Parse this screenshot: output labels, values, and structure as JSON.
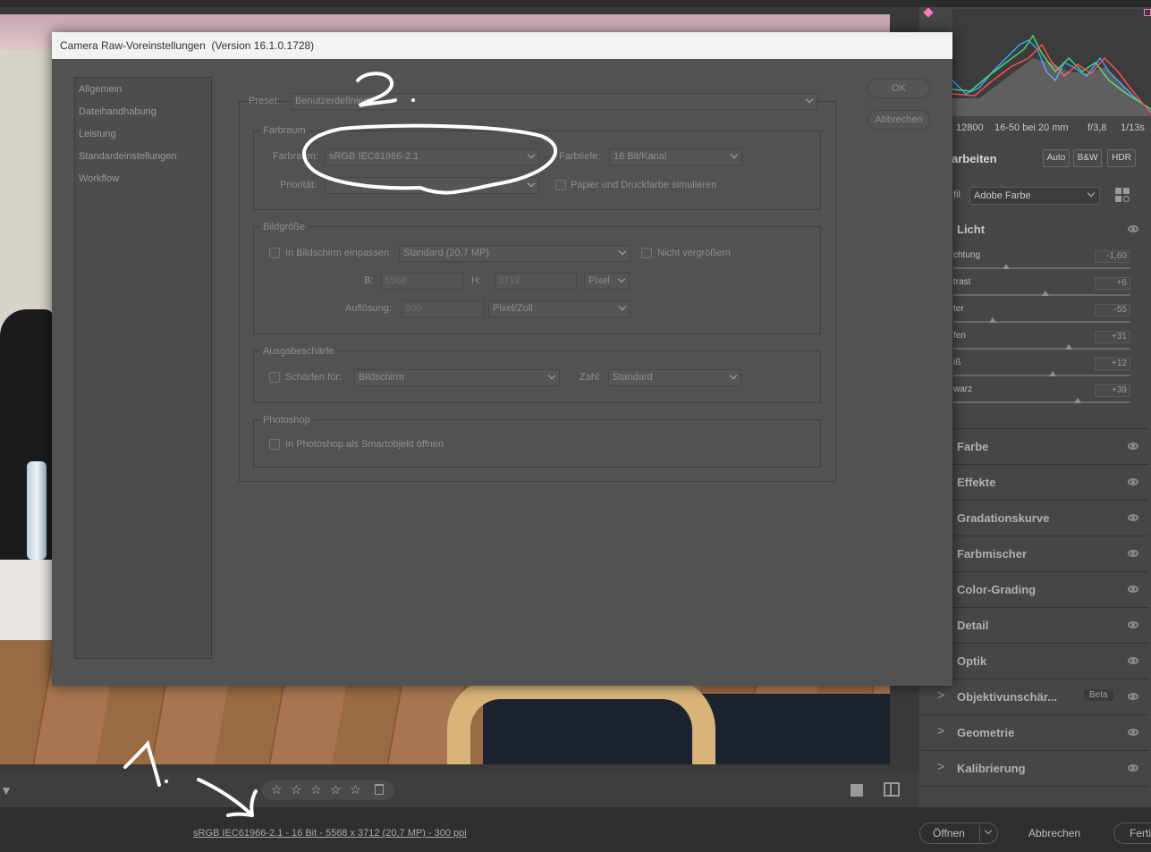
{
  "dialog": {
    "title": "Camera Raw-Voreinstellungen",
    "version": "(Version 16.1.0.1728)",
    "nav": [
      "Allgemein",
      "Dateihandhabung",
      "Leistung",
      "Standardeinstellungen",
      "Workflow"
    ],
    "ok_label": "OK",
    "cancel_label": "Abbrechen",
    "preset_label": "Preset:",
    "preset_value": "Benutzerdefiniert",
    "farbraum": {
      "title": "Farbraum",
      "farbraum_label": "Farbraum:",
      "farbraum_value": "sRGB IEC61966-2.1",
      "farbtiefe_label": "Farbtiefe:",
      "farbtiefe_value": "16 Bit/Kanal",
      "prioritaet_label": "Priorität:",
      "prioritaet_value": "",
      "simulate_label": "Papier und Druckfarbe simulieren"
    },
    "bildgroesse": {
      "title": "Bildgröße",
      "fit_label": "In Bildschirm einpassen:",
      "fit_value": "Standard  (20,7 MP)",
      "no_enlarge_label": "Nicht vergrößern",
      "w_label": "B:",
      "w_value": "5568",
      "h_label": "H:",
      "h_value": "3712",
      "unit_value": "Pixel",
      "res_label": "Auflösung:",
      "res_value": "300",
      "res_unit_value": "Pixel/Zoll"
    },
    "ausgabeschaerfe": {
      "title": "Ausgabeschärfe",
      "sharpen_label": "Schärfen für:",
      "sharpen_value": "Bildschirm",
      "amount_label": "Zahl:",
      "amount_value": "Standard"
    },
    "photoshop": {
      "title": "Photoshop",
      "smart_label": "In Photoshop als Smartobjekt öffnen"
    }
  },
  "annotations": {
    "one": "1.",
    "two": "2."
  },
  "right_panel": {
    "meta": [
      "12800",
      "16-50 bei 20 mm",
      "f/3,8",
      "1/13s"
    ],
    "edit_title": "arbeiten",
    "auto_label": "Auto",
    "bw_label": "B&W",
    "hdr_label": "HDR",
    "profile_label": "fil",
    "profile_value": "Adobe Farbe",
    "licht_title": "Licht",
    "sliders": [
      {
        "label": "chtung",
        "value": "-1,60",
        "knob": 0.3
      },
      {
        "label": "trast",
        "value": "+6",
        "knob": 0.52
      },
      {
        "label": "ter",
        "value": "-55",
        "knob": 0.22
      },
      {
        "label": "fen",
        "value": "+31",
        "knob": 0.65
      },
      {
        "label": "iß",
        "value": "+12",
        "knob": 0.56
      },
      {
        "label": "warz",
        "value": "+39",
        "knob": 0.7
      }
    ],
    "sections": [
      "Farbe",
      "Effekte",
      "Gradationskurve",
      "Farbmischer",
      "Color-Grading",
      "Detail",
      "Optik",
      "Objektivunschär...",
      "Geometrie",
      "Kalibrierung"
    ],
    "beta_label": "Beta"
  },
  "status": {
    "info": "sRGB IEC61966-2.1 - 16 Bit - 5568 x 3712 (20,7 MP) - 300 ppi",
    "open_label": "Öffnen",
    "cancel_label": "Abbrechen",
    "done_label": "Ferti"
  },
  "stars": [
    "☆",
    "☆",
    "☆",
    "☆",
    "☆"
  ]
}
